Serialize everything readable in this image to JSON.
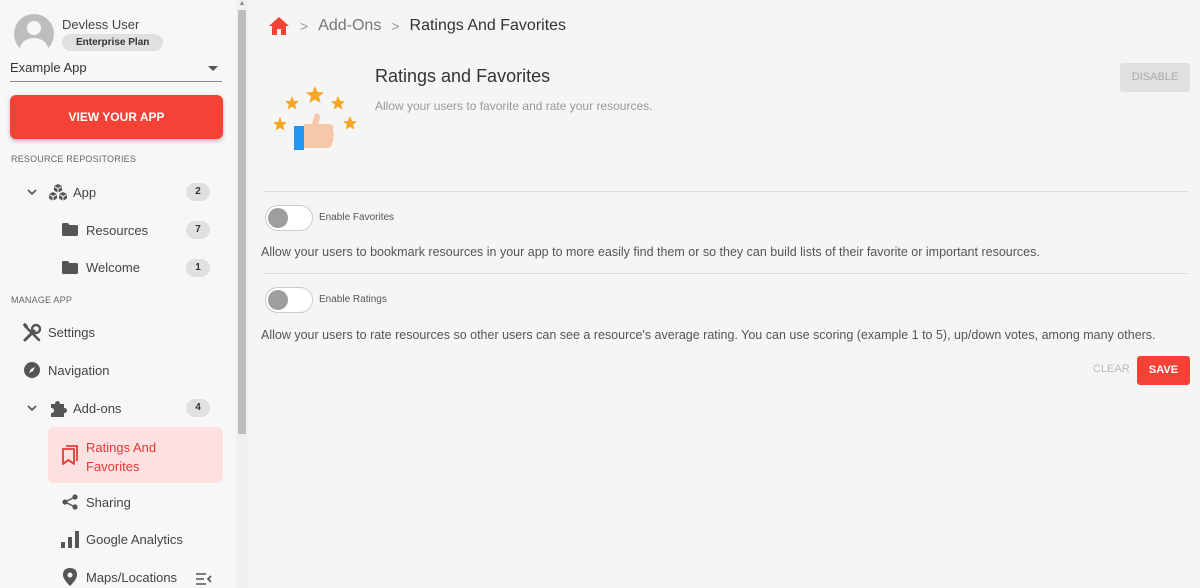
{
  "user": {
    "name": "Devless User",
    "plan": "Enterprise Plan"
  },
  "app_select": {
    "value": "Example App"
  },
  "view_app_label": "VIEW YOUR APP",
  "sidebar": {
    "resource_section": "RESOURCE REPOSITORIES",
    "manage_section": "MANAGE APP",
    "app": {
      "label": "App",
      "count": "2"
    },
    "resources": {
      "label": "Resources",
      "count": "7"
    },
    "welcome": {
      "label": "Welcome",
      "count": "1"
    },
    "settings": {
      "label": "Settings"
    },
    "navigation": {
      "label": "Navigation"
    },
    "addons": {
      "label": "Add-ons",
      "count": "4"
    },
    "ratings": {
      "label_line1": "Ratings And",
      "label_line2": "Favorites"
    },
    "sharing": {
      "label": "Sharing"
    },
    "analytics": {
      "label": "Google Analytics"
    },
    "maps": {
      "label": "Maps/Locations"
    }
  },
  "breadcrumb": {
    "addons": "Add-Ons",
    "current": "Ratings And Favorites"
  },
  "addon": {
    "title": "Ratings and Favorites",
    "description": "Allow your users to favorite and rate your resources.",
    "disable_label": "DISABLE"
  },
  "settings_list": {
    "favorites": {
      "label": "Enable Favorites",
      "enabled": false,
      "description": "Allow your users to bookmark resources in your app to more easily find them or so they can build lists of their favorite or important resources."
    },
    "ratings": {
      "label": "Enable Ratings",
      "enabled": false,
      "description": "Allow your users to rate resources so other users can see a resource's average rating. You can use scoring (example 1 to 5), up/down votes, among many others."
    }
  },
  "actions": {
    "clear_label": "CLEAR",
    "save_label": "SAVE"
  },
  "colors": {
    "accent": "#f44336",
    "active_bg": "#fde0e0"
  }
}
